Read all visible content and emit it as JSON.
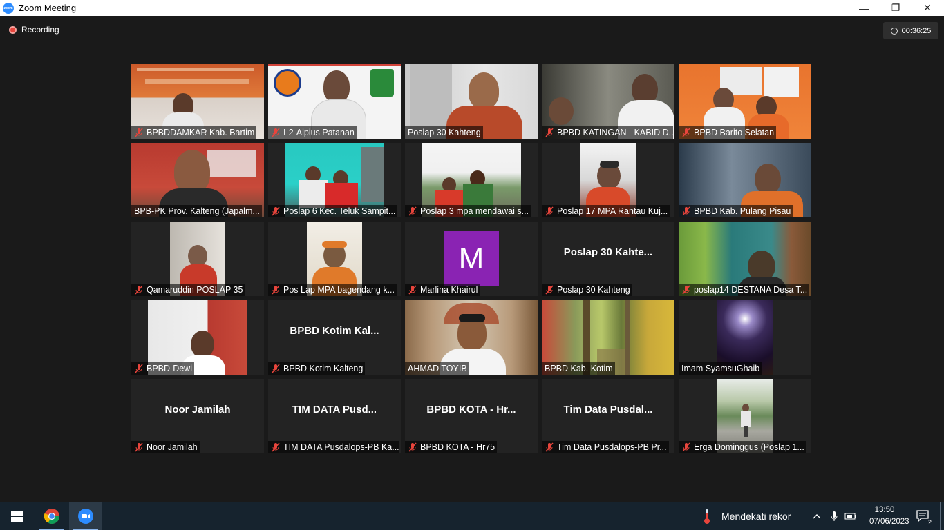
{
  "window": {
    "title": "Zoom Meeting",
    "logo_text": "zoom",
    "minimize_symbol": "—",
    "maximize_symbol": "❐",
    "close_symbol": "✕"
  },
  "meeting": {
    "recording_label": "Recording",
    "timer": "00:36:25",
    "participants": [
      {
        "label": "BPBDDAMKAR Kab. Bartim",
        "muted": true,
        "video": "photo"
      },
      {
        "label": "I-2-Alpius Patanan",
        "muted": true,
        "video": "photo"
      },
      {
        "label": "Poslap 30 Kahteng",
        "muted": false,
        "video": "photo"
      },
      {
        "label": "BPBD KATINGAN - KABID D...",
        "muted": true,
        "video": "photo"
      },
      {
        "label": "BPBD Barito Selatan",
        "muted": true,
        "video": "photo"
      },
      {
        "label": "BPB-PK Prov. Kalteng (Japalm...",
        "muted": false,
        "video": "photo"
      },
      {
        "label": "Poslap 6 Kec. Teluk Sampit...",
        "muted": true,
        "video": "photo"
      },
      {
        "label": "Poslap 3 mpa mendawai s...",
        "muted": true,
        "video": "photo"
      },
      {
        "label": "Poslap 17 MPA Rantau Kuj...",
        "muted": true,
        "video": "photo"
      },
      {
        "label": "BPBD Kab. Pulang Pisau",
        "muted": true,
        "video": "photo"
      },
      {
        "label": "Qamaruddin POSLAP 35",
        "muted": true,
        "video": "photo"
      },
      {
        "label": "Pos Lap MPA bagendang k...",
        "muted": true,
        "video": "photo"
      },
      {
        "label": "Marlina Khairul",
        "muted": true,
        "video": "avatar",
        "avatar_letter": "M"
      },
      {
        "label": "Poslap 30 Kahteng",
        "muted": true,
        "video": "name",
        "name_card": "Poslap 30 Kahte..."
      },
      {
        "label": "poslap14 DESTANA Desa T...",
        "muted": true,
        "video": "photo"
      },
      {
        "label": "BPBD-Dewi",
        "muted": true,
        "video": "photo"
      },
      {
        "label": "BPBD Kotim Kalteng",
        "muted": true,
        "video": "name",
        "name_card": "BPBD Kotim Kal..."
      },
      {
        "label": "AHMAD TOYIB",
        "muted": false,
        "video": "photo",
        "active_speaker": true
      },
      {
        "label": "BPBD Kab. Kotim",
        "muted": false,
        "video": "photo"
      },
      {
        "label": "Imam SyamsuGhaib",
        "muted": false,
        "video": "photo"
      },
      {
        "label": "Noor Jamilah",
        "muted": true,
        "video": "name",
        "name_card": "Noor Jamilah"
      },
      {
        "label": "TIM DATA Pusdalops-PB Ka...",
        "muted": true,
        "video": "name",
        "name_card": "TIM DATA Pusd..."
      },
      {
        "label": "BPBD KOTA - Hr75",
        "muted": true,
        "video": "name",
        "name_card": "BPBD KOTA - Hr..."
      },
      {
        "label": "Tim Data Pusdalops-PB Pr...",
        "muted": true,
        "video": "name",
        "name_card": "Tim Data Pusdal..."
      },
      {
        "label": "Erga Dominggus (Poslap 1...",
        "muted": true,
        "video": "photo"
      }
    ]
  },
  "taskbar": {
    "apps": [
      "start-icon",
      "chrome-icon",
      "zoom-icon"
    ],
    "weather_text": "Mendekati rekor",
    "time": "13:50",
    "date": "07/06/2023",
    "notification_count": "2"
  },
  "colors": {
    "active_speaker_border": "#d8e82a",
    "mute_icon": "#e8453c",
    "avatar_bg": "#8a23b3",
    "taskbar_bg": "#16232e"
  }
}
